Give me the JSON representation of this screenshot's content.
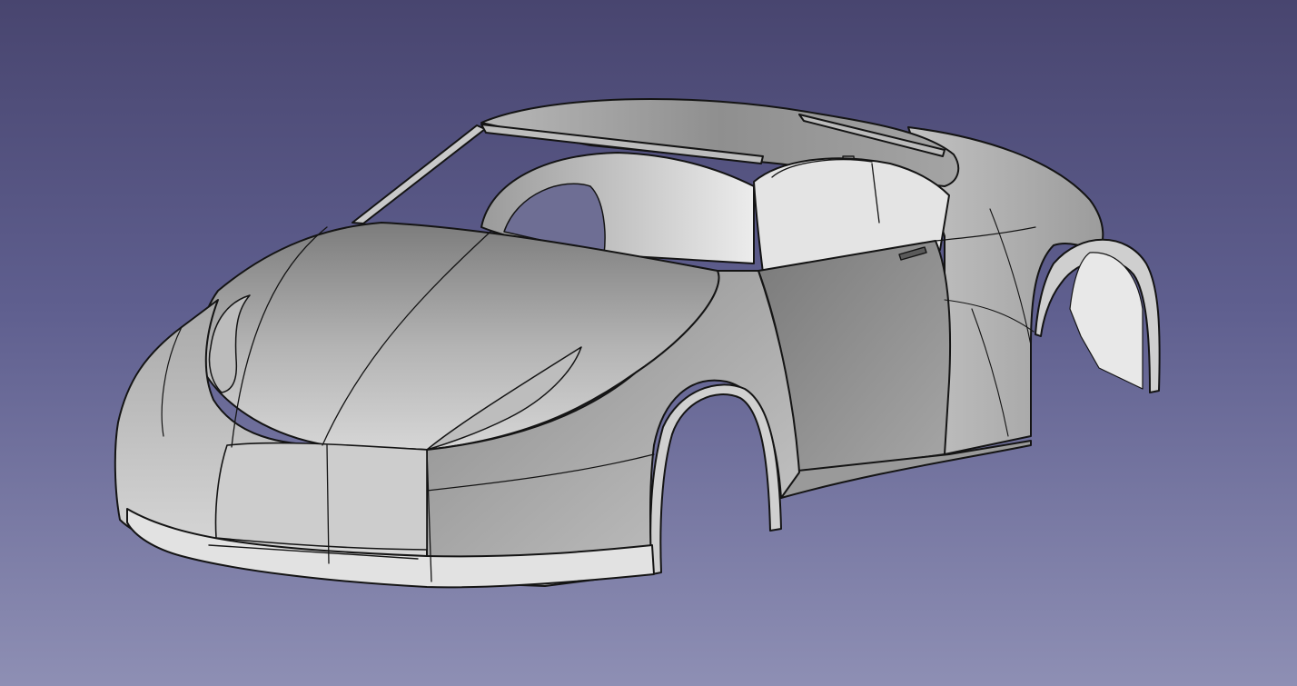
{
  "viewport": {
    "background_top": "#48456f",
    "background_bottom": "#8e8fb4"
  },
  "model": {
    "kind": "car-body-shell",
    "shading": "grey-solid-with-edges",
    "body_color": "#a9a9a9",
    "edge_color": "#141414"
  }
}
